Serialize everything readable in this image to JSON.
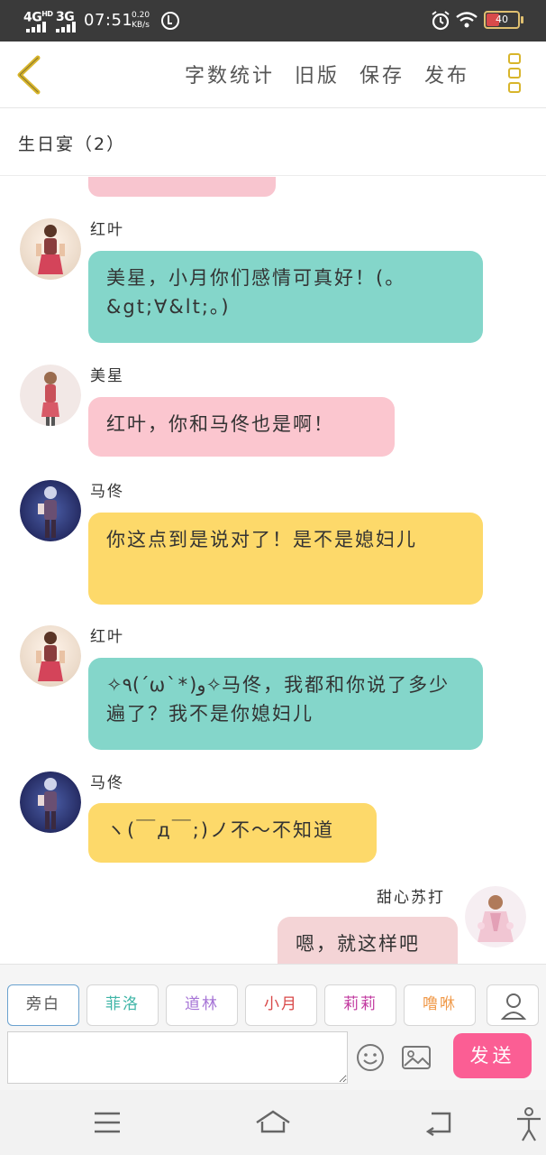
{
  "status_bar": {
    "network_1": "4G",
    "network_1_sub": "HD",
    "network_2": "3G",
    "time": "07:51",
    "speed_value": "0.20",
    "speed_unit": "KB/s",
    "battery": "40",
    "battery_level": 0.4,
    "battery_color": "#d84a4a"
  },
  "header": {
    "back_icon": "chevron-left-icon",
    "actions": [
      "字数统计",
      "旧版",
      "保存",
      "发布"
    ],
    "menu_icon": "three-dots-vertical-icon",
    "accent": "#d8b52b"
  },
  "chat": {
    "title": "生日宴（2）",
    "messages": [
      {
        "sender": "红叶",
        "text": "美星，小月你们感情可真好！(。&gt;∀&lt;。)",
        "color": "#84d6ca"
      },
      {
        "sender": "美星",
        "text": "红叶，你和马佟也是啊！",
        "color": "#fbc6cf"
      },
      {
        "sender": "马佟",
        "text": "你这点到是说对了！是不是媳妇儿",
        "color": "#fdd96a"
      },
      {
        "sender": "红叶",
        "text": "✧٩(ˊωˋ*)و✧马佟，我都和你说了多少遍了？我不是你媳妇儿",
        "color": "#84d6ca"
      },
      {
        "sender": "马佟",
        "text": "ヽ(￣д￣;)ノ不～不知道",
        "color": "#fdd96a"
      },
      {
        "sender": "甜心苏打",
        "text": "嗯，就这样吧",
        "color": "#f4d4d6"
      }
    ]
  },
  "composer": {
    "roles": [
      {
        "label": "旁白",
        "color": "#555555"
      },
      {
        "label": "菲洛",
        "color": "#3fb5a7"
      },
      {
        "label": "道林",
        "color": "#a674d6"
      },
      {
        "label": "小月",
        "color": "#d94848"
      },
      {
        "label": "莉莉",
        "color": "#c23aa0"
      },
      {
        "label": "噜咻",
        "color": "#f09a4a"
      }
    ],
    "role_more_icon": "person-icon",
    "input_placeholder": "",
    "emoji_icon": "smiley-icon",
    "image_icon": "image-icon",
    "send_label": "发送",
    "send_color": "#fb5e94"
  },
  "navbar": {
    "menu_icon": "menu-icon",
    "home_icon": "home-icon",
    "back_icon": "back-icon",
    "accessibility_icon": "accessibility-icon"
  }
}
